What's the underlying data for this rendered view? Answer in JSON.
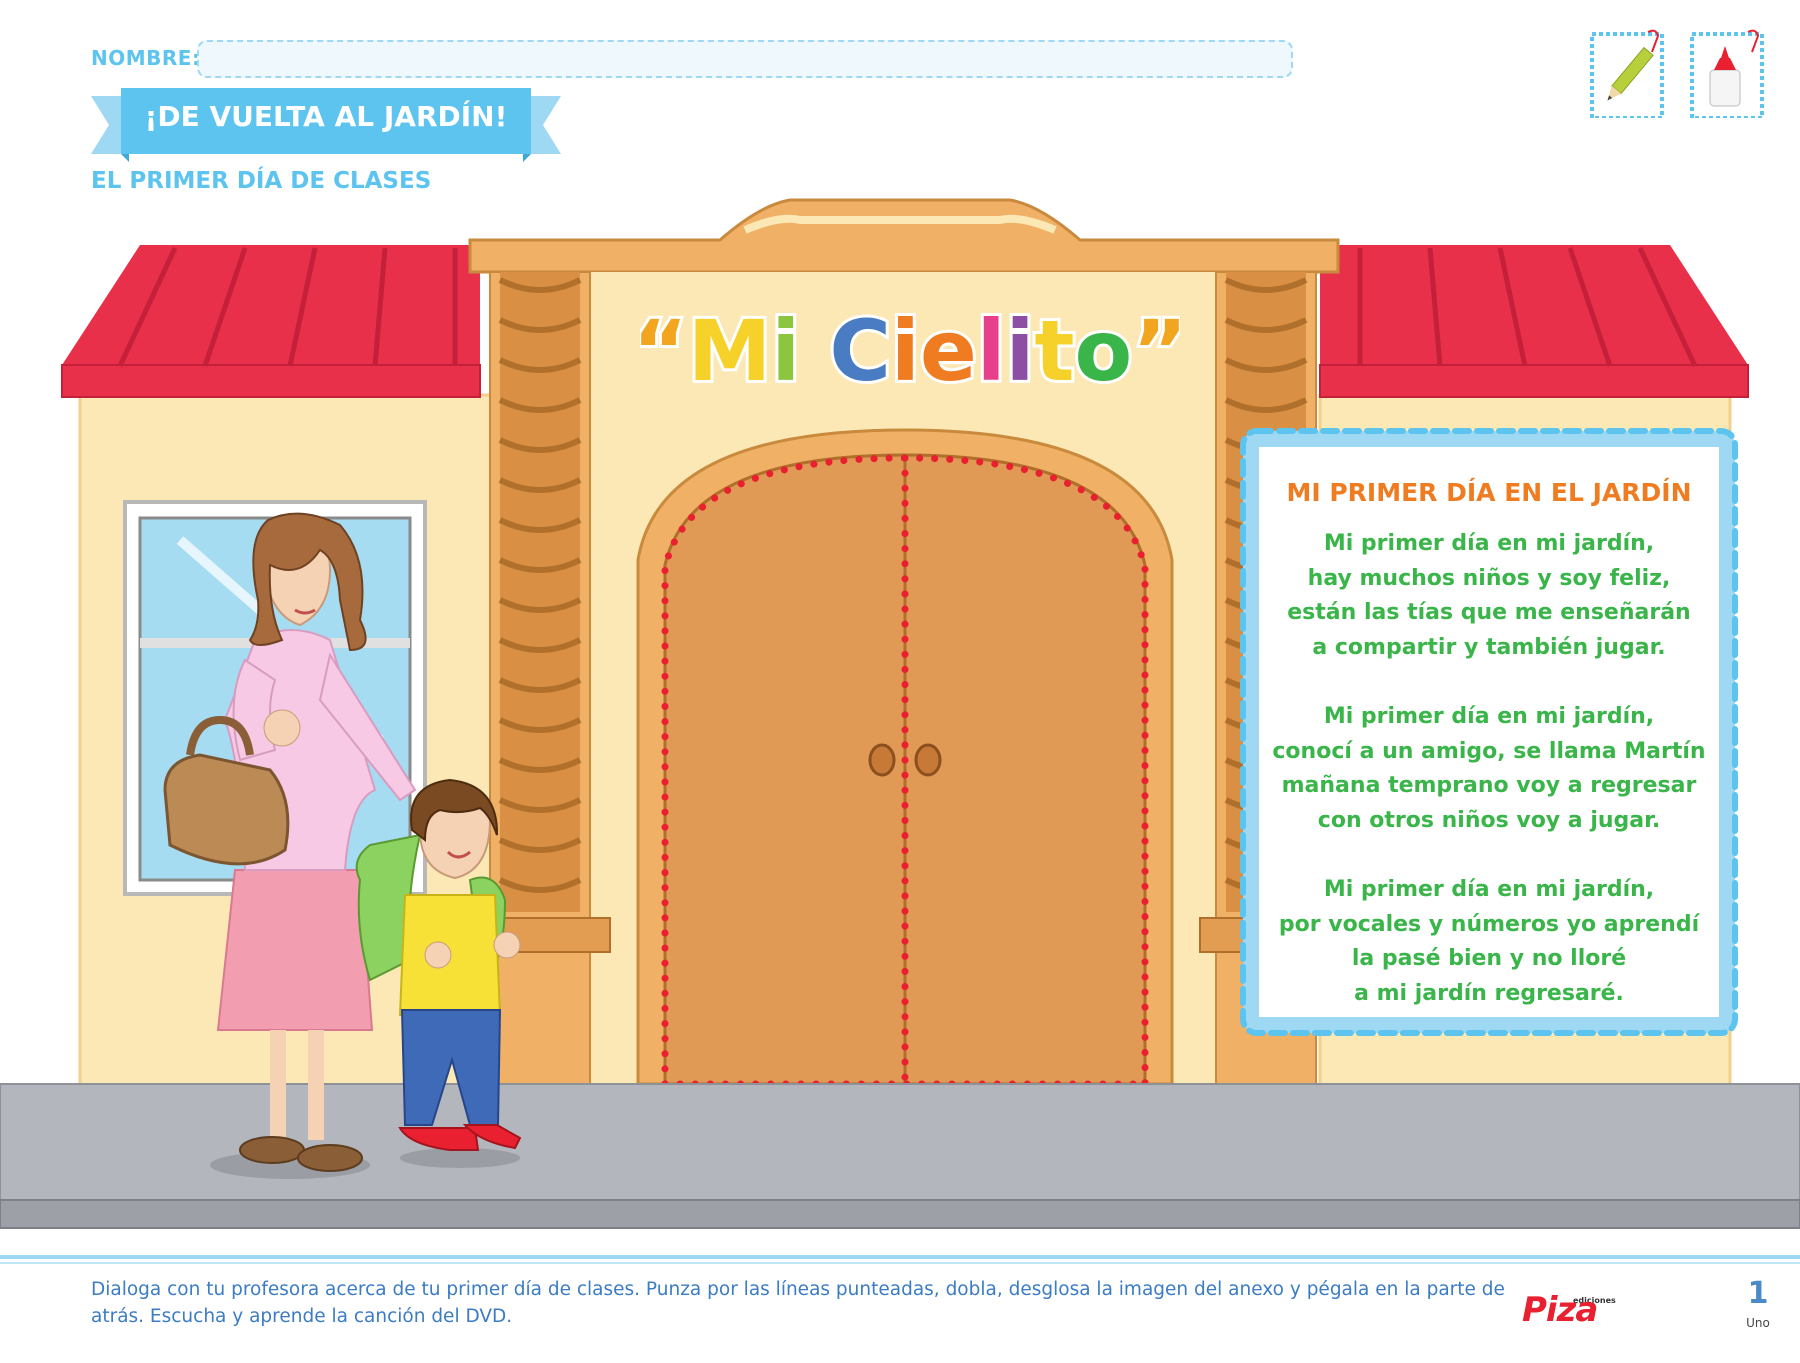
{
  "header": {
    "name_label": "NOMBRE:",
    "banner_title": "¡DE VUELTA AL JARDÍN!",
    "subtitle": "EL PRIMER DÍA DE CLASES",
    "icons": [
      "pencil-icon",
      "glue-icon"
    ]
  },
  "school": {
    "sign": "“Mi Cielito”",
    "sign_colors": [
      "#f2a51f",
      "#f5d12a",
      "#8cc63e",
      "#4a7cc4",
      "#f07c22",
      "#f07c22",
      "#e83f8c",
      "#8d4fa3",
      "#f5d12a",
      "#3ab54a"
    ]
  },
  "poem": {
    "title": "MI PRIMER DÍA EN EL JARDÍN",
    "stanzas": [
      [
        "Mi primer día en mi jardín,",
        "hay muchos niños y soy feliz,",
        "están las tías que me enseñarán",
        "a compartir y también jugar."
      ],
      [
        "Mi primer día en mi jardín,",
        "conocí a un amigo, se llama Martín",
        "mañana temprano voy a regresar",
        "con otros niños voy a jugar."
      ],
      [
        "Mi primer día en mi jardín,",
        "por vocales y números yo aprendí",
        "la pasé bien y no lloré",
        "a mi jardín regresaré."
      ]
    ]
  },
  "footer": {
    "instructions": "Dialoga con tu profesora acerca de tu primer día de clases. Punza por las líneas punteadas, dobla, desglosa la imagen del anexo y pégala en la parte de atrás. Escucha y aprende la canción del DVD.",
    "logo_small": "ediciones",
    "logo": "Piza",
    "page_number": "1",
    "page_word": "Uno"
  },
  "colors": {
    "accent_blue": "#5cc4ee",
    "roof_red": "#e8304a",
    "wall_cream": "#fbe8b4",
    "door_brown": "#e09a56",
    "poem_orange": "#f07c22",
    "poem_green": "#3ab54a",
    "dotted_red": "#e8202f"
  }
}
